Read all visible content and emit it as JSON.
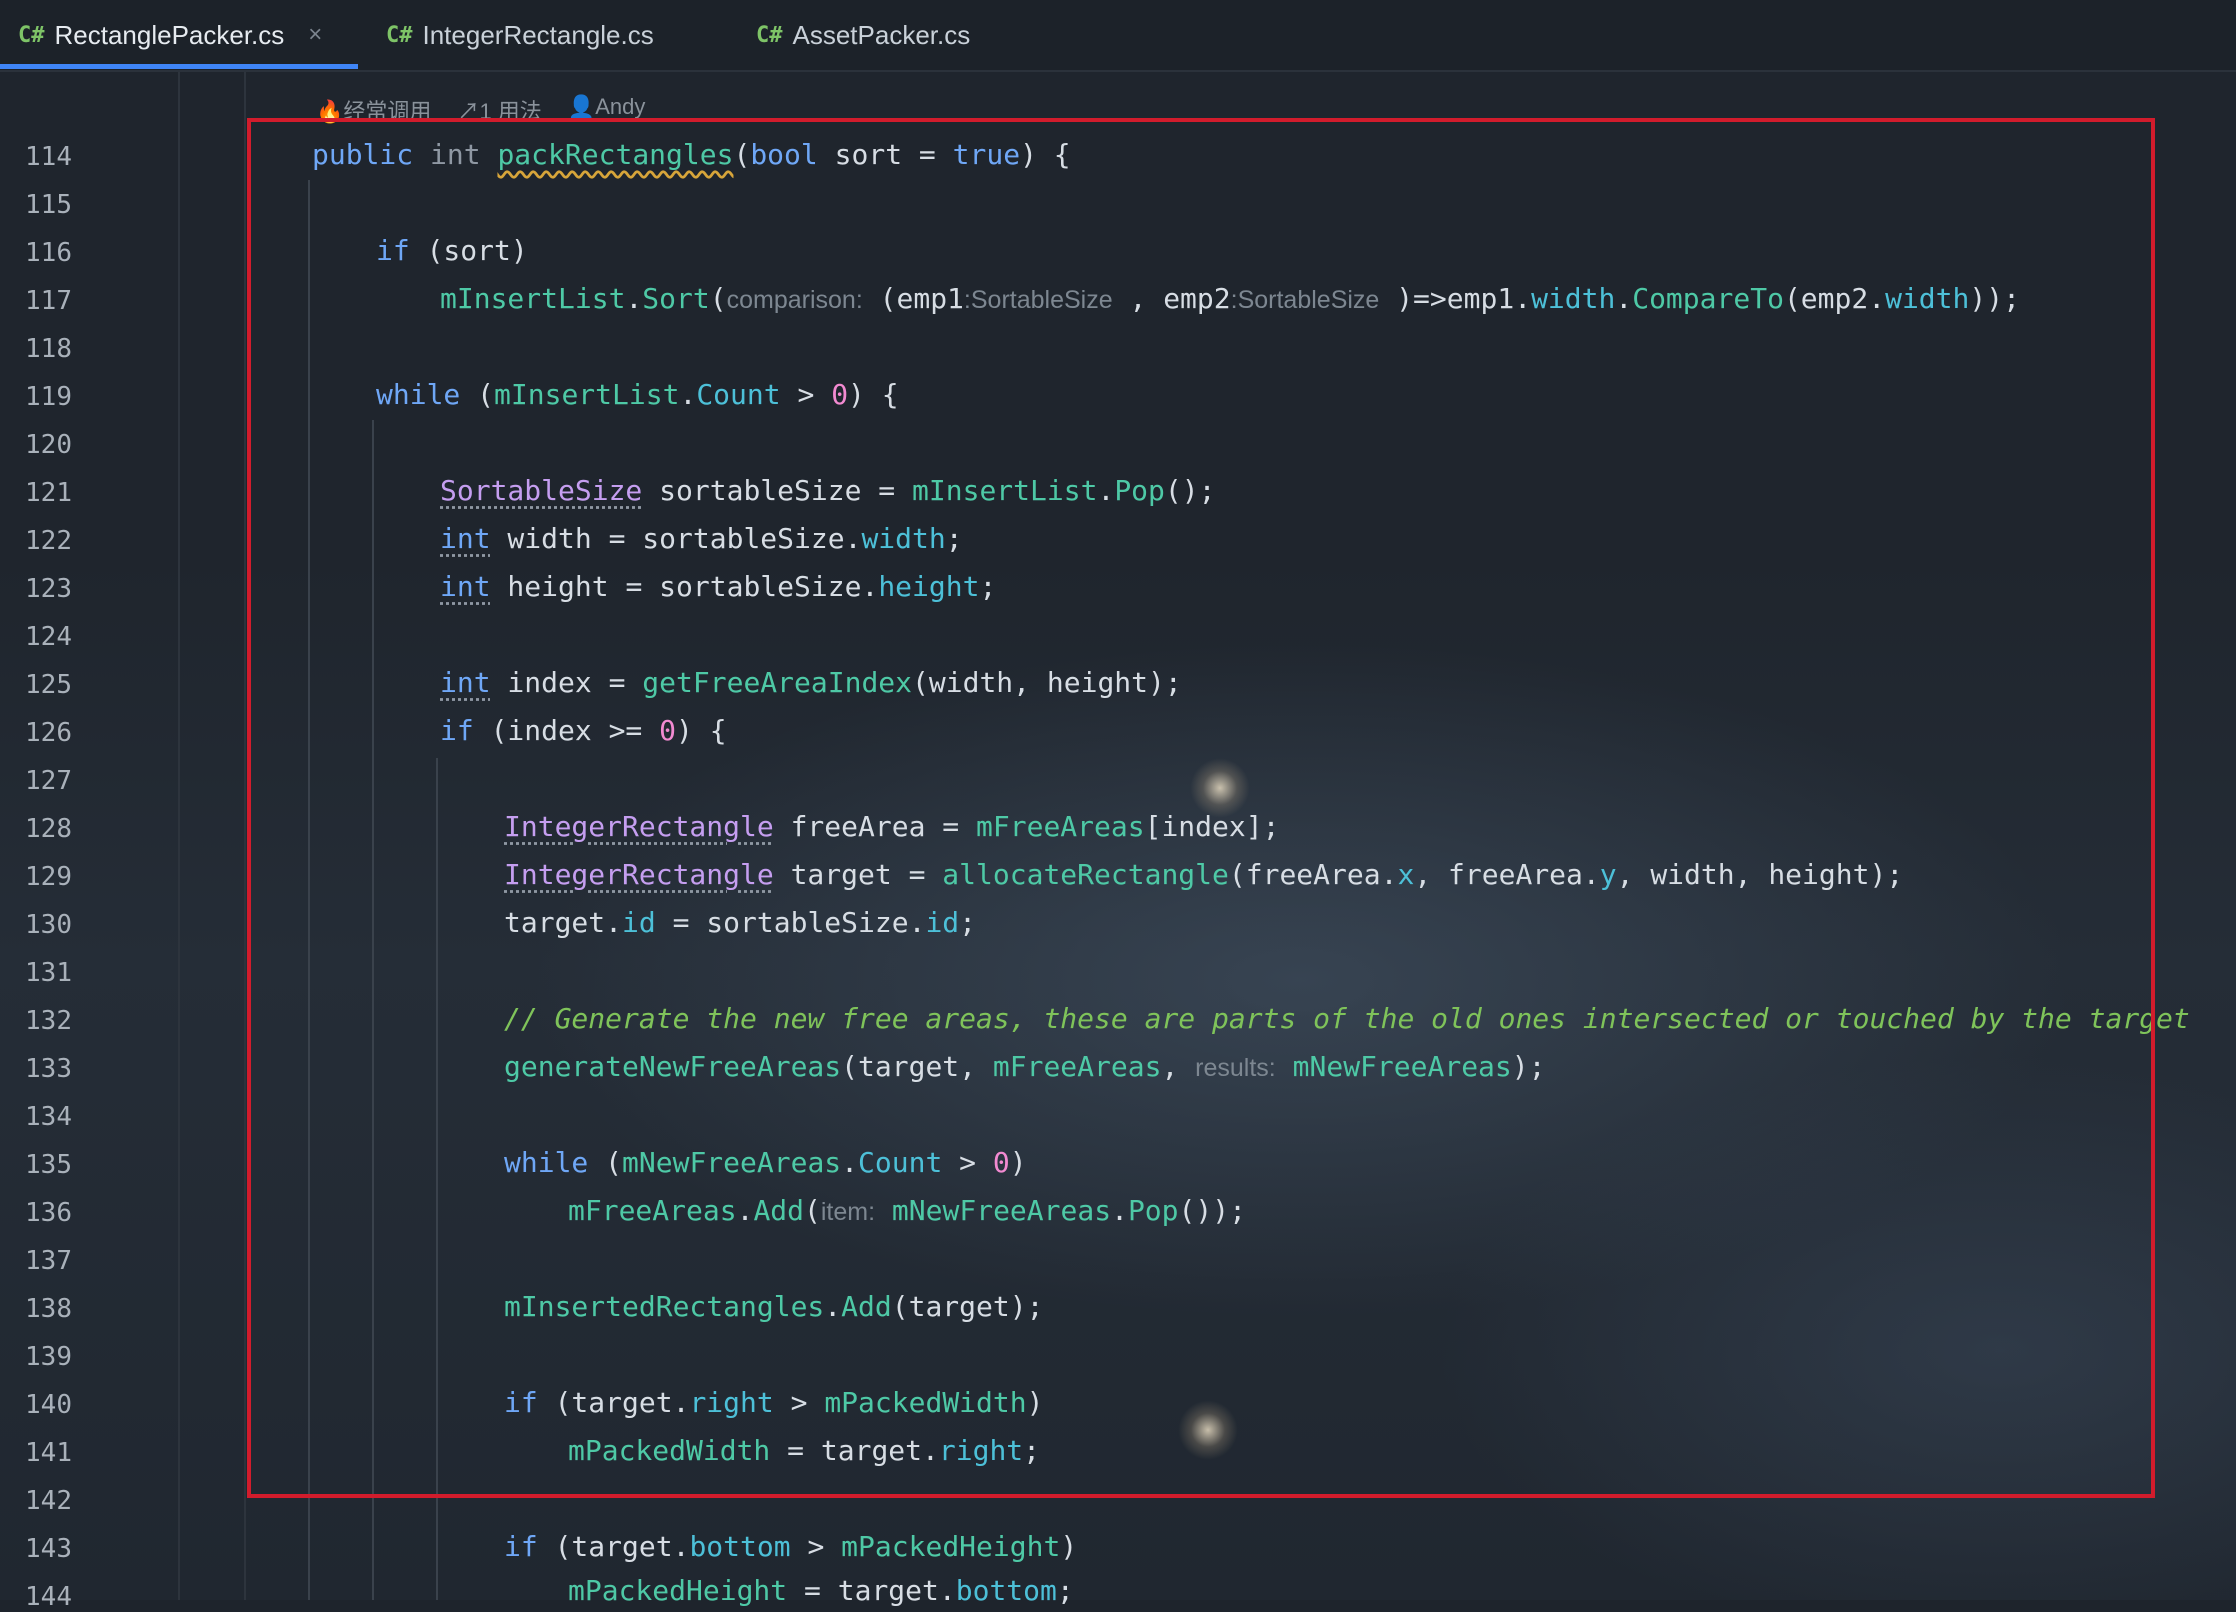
{
  "tabs": [
    {
      "lang": "C#",
      "label": "RectanglePacker.cs",
      "close": "×",
      "active": true
    },
    {
      "lang": "C#",
      "label": "IntegerRectangle.cs",
      "active": false
    },
    {
      "lang": "C#",
      "label": "AssetPacker.cs",
      "active": false
    }
  ],
  "hints": {
    "frequent": "经常调用",
    "usages": "1 用法",
    "author": "Andy"
  },
  "line_numbers": [
    "114",
    "115",
    "116",
    "117",
    "118",
    "119",
    "120",
    "121",
    "122",
    "123",
    "124",
    "125",
    "126",
    "127",
    "128",
    "129",
    "130",
    "131",
    "132",
    "133",
    "134",
    "135",
    "136",
    "137",
    "138",
    "139",
    "140",
    "141",
    "142",
    "143",
    "144"
  ],
  "code": {
    "l114": {
      "public": "public",
      "int": "int",
      "name": "packRectangles",
      "rest1": "(",
      "bool": "bool",
      "rest2": " sort = ",
      "true": "true",
      "rest3": ") {"
    },
    "l116": {
      "if": "if",
      "rest": " (sort)"
    },
    "l117": {
      "obj": "mInsertList",
      "dot1": ".",
      "sort": "Sort",
      "p1": "(",
      "hint1": "comparison:",
      "p2": " (emp1",
      "hint2": ":SortableSize",
      "p3": " , emp2",
      "hint3": ":SortableSize",
      "p4": " )=>emp1.",
      "w1": "width",
      "dot2": ".",
      "cmp": "CompareTo",
      "p5": "(emp2.",
      "w2": "width",
      "p6": "));"
    },
    "l119": {
      "while": "while",
      "p1": " (",
      "obj": "mInsertList",
      "dot": ".",
      "count": "Count",
      "p2": " > ",
      "zero": "0",
      "p3": ") {"
    },
    "l121": {
      "type": "SortableSize",
      "p1": " sortableSize = ",
      "obj": "mInsertList",
      "dot": ".",
      "pop": "Pop",
      "p2": "();"
    },
    "l122": {
      "int": "int",
      "p1": " width = sortableSize.",
      "prop": "width",
      "p2": ";"
    },
    "l123": {
      "int": "int",
      "p1": " height = sortableSize.",
      "prop": "height",
      "p2": ";"
    },
    "l125": {
      "int": "int",
      "p1": " index = ",
      "fn": "getFreeAreaIndex",
      "p2": "(width, height);"
    },
    "l126": {
      "if": "if",
      "p1": " (index >= ",
      "zero": "0",
      "p2": ") {"
    },
    "l128": {
      "type": "IntegerRectangle",
      "p1": " freeArea = ",
      "obj": "mFreeAreas",
      "p2": "[index];"
    },
    "l129": {
      "type": "IntegerRectangle",
      "p1": " target = ",
      "fn": "allocateRectangle",
      "p2": "(freeArea.",
      "x": "x",
      "p3": ", freeArea.",
      "y": "y",
      "p4": ", width, height);"
    },
    "l130": {
      "p1": "target.",
      "id1": "id",
      "p2": " = sortableSize.",
      "id2": "id",
      "p3": ";"
    },
    "l132": {
      "comment": "// Generate the new free areas, these are parts of the old ones intersected or touched by the target"
    },
    "l133": {
      "fn": "generateNewFreeAreas",
      "p1": "(target, ",
      "obj": "mFreeAreas",
      "p2": ", ",
      "hint": "results:",
      "p3": " ",
      "obj2": "mNewFreeAreas",
      "p4": ");"
    },
    "l135": {
      "while": "while",
      "p1": " (",
      "obj": "mNewFreeAreas",
      "dot": ".",
      "count": "Count",
      "p2": " > ",
      "zero": "0",
      "p3": ")"
    },
    "l136": {
      "obj": "mFreeAreas",
      "dot": ".",
      "add": "Add",
      "p1": "(",
      "hint": "item:",
      "p2": " ",
      "obj2": "mNewFreeAreas",
      "dot2": ".",
      "pop": "Pop",
      "p3": "());"
    },
    "l138": {
      "obj": "mInsertedRectangles",
      "dot": ".",
      "add": "Add",
      "p1": "(target);"
    },
    "l140": {
      "if": "if",
      "p1": " (target.",
      "prop": "right",
      "p2": " > ",
      "obj": "mPackedWidth",
      "p3": ")"
    },
    "l141": {
      "obj": "mPackedWidth",
      "p1": " = target.",
      "prop": "right",
      "p2": ";"
    },
    "l143": {
      "if": "if",
      "p1": " (target.",
      "prop": "bottom",
      "p2": " > ",
      "obj": "mPackedHeight",
      "p3": ")"
    },
    "l144": {
      "obj": "mPackedHeight",
      "p1": " = target.",
      "prop": "bottom",
      "p2": ";"
    }
  },
  "colors": {
    "background": "#1e242c",
    "keyword": "#6fa7f6",
    "function": "#4ec9a6",
    "type": "#c59ef0",
    "number": "#f28ad1",
    "comment": "#7fc35a",
    "highlight_border": "#d21c2c",
    "active_tab_underline": "#3f85f6"
  }
}
